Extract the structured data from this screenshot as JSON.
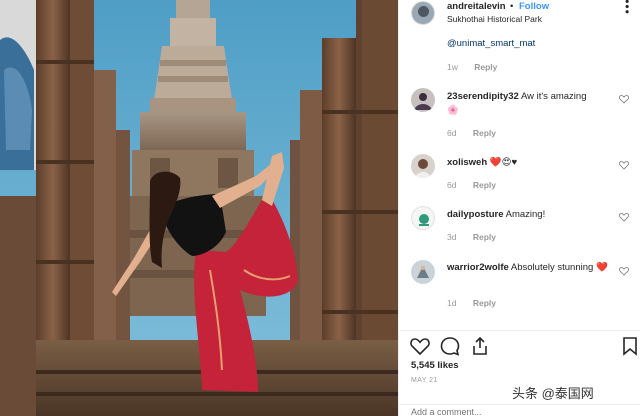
{
  "header": {
    "username": "andreitalevin",
    "separator": "•",
    "follow_label": "Follow",
    "location": "Sukhothai Historical Park",
    "more_icon": "ellipsis-icon"
  },
  "caption": {
    "mention": "@unimat_smart_mat",
    "time": "1w",
    "reply": "Reply"
  },
  "comments": [
    {
      "user": "23serendipity32",
      "text": "Aw it's amazing",
      "emoji": "🌸",
      "time": "6d",
      "reply": "Reply"
    },
    {
      "user": "xolisweh",
      "text": "",
      "emoji": "❤️😍♥",
      "time": "6d",
      "reply": "Reply"
    },
    {
      "user": "dailyposture",
      "text": "Amazing!",
      "emoji": "",
      "time": "3d",
      "reply": "Reply"
    },
    {
      "user": "warrior2wolfe",
      "text": "Absolutely stunning",
      "emoji": "❤️",
      "time": "1d",
      "reply": "Reply"
    }
  ],
  "post": {
    "likes": "5,545 likes",
    "date": "MAY 21",
    "comment_placeholder": "Add a comment..."
  },
  "watermark": "头条 @泰国网",
  "colors": {
    "link": "#3897f0",
    "mention": "#003569",
    "muted": "#999999",
    "text": "#262626",
    "sky": "#5fa9cf",
    "dress": "#c4233a"
  }
}
